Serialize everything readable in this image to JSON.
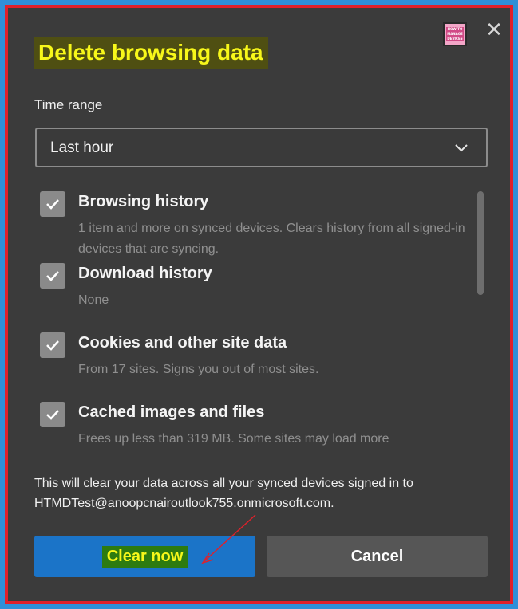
{
  "dialog": {
    "title": "Delete browsing data",
    "close_glyph": "✕",
    "logo_text": "HOW TO MANAGE DEVICES"
  },
  "time_range": {
    "label": "Time range",
    "selected": "Last hour"
  },
  "items": [
    {
      "label": "Browsing history",
      "description": "1 item and more on synced devices. Clears history from all signed-in devices that are syncing.",
      "checked": true
    },
    {
      "label": "Download history",
      "description": "None",
      "checked": true
    },
    {
      "label": "Cookies and other site data",
      "description": "From 17 sites. Signs you out of most sites.",
      "checked": true
    },
    {
      "label": "Cached images and files",
      "description": "Frees up less than 319 MB. Some sites may load more",
      "checked": true
    }
  ],
  "notice": "This will clear your data across all your synced devices signed in to HTMDTest@anoopcnairoutlook755.onmicrosoft.com.",
  "buttons": {
    "clear": "Clear now",
    "cancel": "Cancel"
  },
  "colors": {
    "background": "#3b3b3b",
    "accent": "#1b74c8",
    "highlight": "#f7f71a",
    "frame": "#e0202a"
  }
}
